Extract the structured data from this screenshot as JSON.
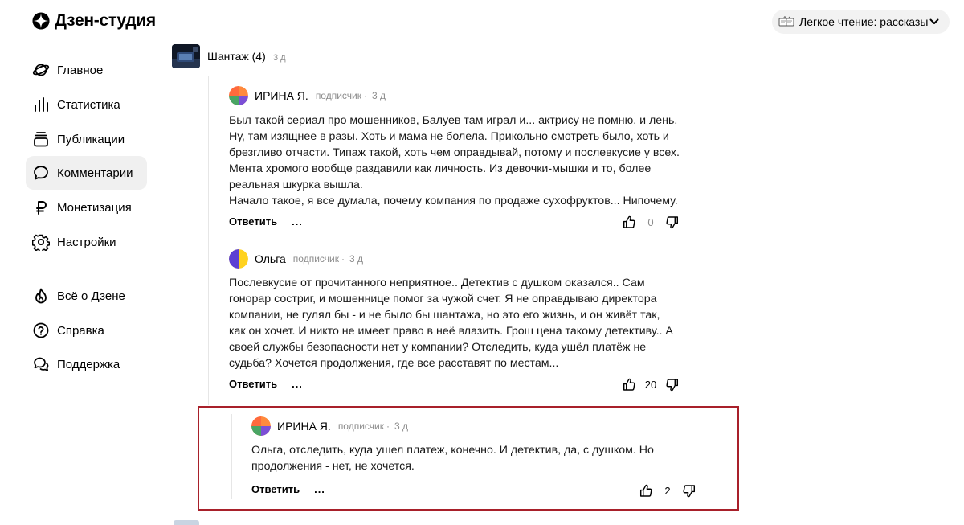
{
  "header": {
    "logo_text": "Дзен-студия",
    "channel": {
      "name": "Легкое чтение: рассказы"
    }
  },
  "sidebar": {
    "items": [
      {
        "label": "Главное",
        "icon": "planet-icon",
        "active": false
      },
      {
        "label": "Статистика",
        "icon": "bar-chart-icon",
        "active": false
      },
      {
        "label": "Публикации",
        "icon": "publications-icon",
        "active": false
      },
      {
        "label": "Комментарии",
        "icon": "comment-icon",
        "active": true
      },
      {
        "label": "Монетизация",
        "icon": "ruble-icon",
        "active": false
      },
      {
        "label": "Настройки",
        "icon": "gear-icon",
        "active": false
      },
      {
        "label": "Всё о Дзене",
        "icon": "flame-icon",
        "active": false
      },
      {
        "label": "Справка",
        "icon": "help-icon",
        "active": false
      },
      {
        "label": "Поддержка",
        "icon": "support-icon",
        "active": false
      }
    ]
  },
  "post": {
    "title": "Шантаж (4)",
    "time": "3 д"
  },
  "comments": [
    {
      "author": "ИРИНА Я.",
      "role": "подписчик",
      "dot": "·",
      "time": "3 д",
      "lines": [
        "Был такой сериал про мошенников, Балуев там играл и... актрису не помню, и лень.",
        "Ну, там изящнее в разы. Хоть и мама не болела. Прикольно смотреть было, хоть и",
        "брезгливо отчасти. Типаж такой, хоть чем оправдывай, потому и послевкусие у всех.",
        "Мента хромого вообще раздавили как личность. Из девочки-мышки и то, более",
        "реальная шкурка вышла.",
        "Начало такое, я все думала, почему компания по продаже сухофруктов... Нипочему."
      ],
      "reply_label": "Ответить",
      "more_label": "...",
      "likes": "0"
    },
    {
      "author": "Ольга",
      "role": "подписчик",
      "dot": "·",
      "time": "3 д",
      "lines": [
        "Послевкусие от прочитанного неприятное.. Детектив с душком оказался.. Сам",
        "гонорар состриг, и мошеннице помог за чужой счет. Я не оправдываю директора",
        "компании, не гулял бы - и не было бы шантажа, но это его жизнь, и он живёт так,",
        "как он хочет. И никто не имеет право в неё влазить. Грош цена такому детективу.. А",
        "своей службы безопасности нет у компании? Отследить, куда ушёл платёж не",
        "судьба? Хочется продолжения, где все расставят по местам..."
      ],
      "reply_label": "Ответить",
      "more_label": "...",
      "likes": "20"
    },
    {
      "author": "ИРИНА Я.",
      "role": "подписчик",
      "dot": "·",
      "time": "3 д",
      "lines": [
        "Ольга, отследить, куда ушел платеж, конечно. И детектив, да, с душком. Но",
        "продолжения - нет, не хочется."
      ],
      "reply_label": "Ответить",
      "more_label": "...",
      "likes": "2"
    }
  ],
  "colors": {
    "highlight_border": "#a8202a",
    "active_nav_bg": "#f0f0f0",
    "meta_text": "#8c8c8c"
  }
}
